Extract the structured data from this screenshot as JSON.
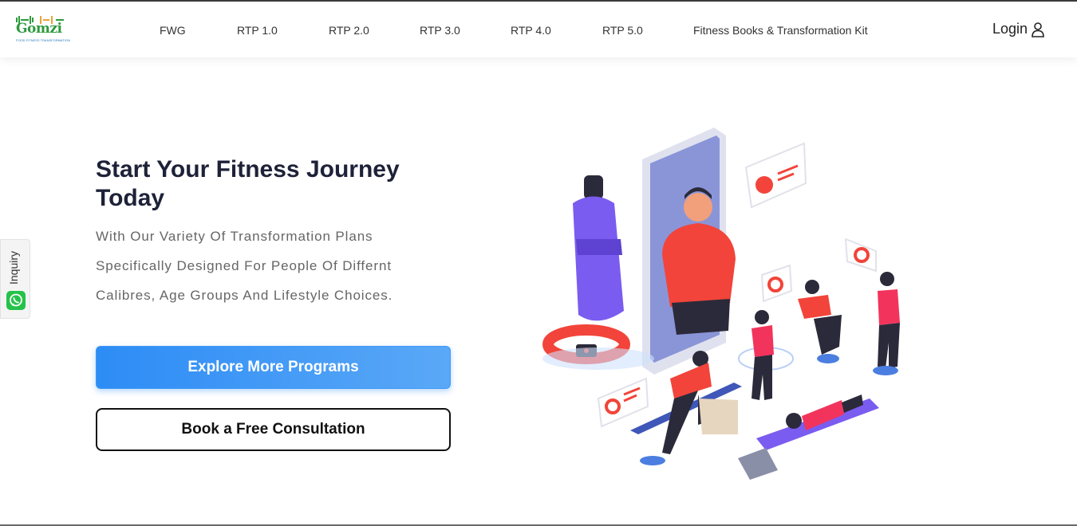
{
  "header": {
    "logo": {
      "brand": "Gomzi",
      "tagline": "FOOD FITNESS TRANSFORMATION"
    },
    "nav": [
      "FWG",
      "RTP 1.0",
      "RTP 2.0",
      "RTP 3.0",
      "RTP 4.0",
      "RTP 5.0",
      "Fitness Books & Transformation Kit"
    ],
    "login_label": "Login"
  },
  "hero": {
    "title": "Start Your Fitness Journey Today",
    "subtitle_lines": [
      "With Our Variety Of Transformation Plans",
      "Specifically Designed For People Of Differnt",
      "Calibres, Age Groups And Lifestyle Choices."
    ],
    "primary_button": "Explore More Programs",
    "secondary_button": "Book a Free Consultation"
  },
  "inquiry": {
    "label": "Inquiry"
  },
  "colors": {
    "accent": "#2d8cf5",
    "brand_green": "#2d9a3c",
    "heading": "#1e2238",
    "illustration_red": "#f2443a",
    "illustration_purple": "#7b5cf0"
  }
}
